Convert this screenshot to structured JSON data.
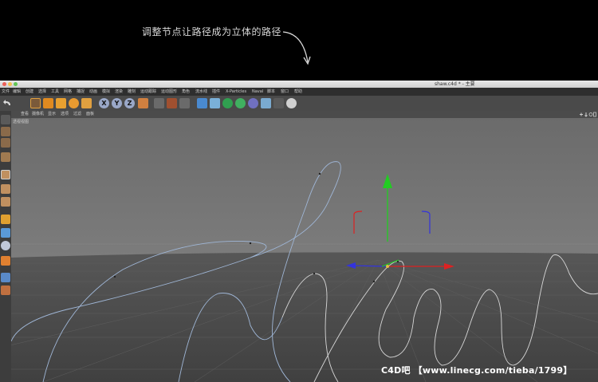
{
  "banner": {
    "caption": "调整节点让路径成为立体的路径"
  },
  "window": {
    "title": "shaw.c4d * - 主要"
  },
  "menu": {
    "items": [
      "文件",
      "编辑",
      "创建",
      "选择",
      "工具",
      "网格",
      "捕捉",
      "动画",
      "模拟",
      "渲染",
      "雕刻",
      "运动跟踪",
      "运动图形",
      "角色",
      "流水线",
      "插件",
      "X-Particles",
      "Naval",
      "脚本",
      "窗口",
      "帮助"
    ]
  },
  "viewport_menu": {
    "items": [
      "查看",
      "摄像机",
      "显示",
      "选项",
      "过滤",
      "面板"
    ]
  },
  "viewport": {
    "label": "透视视图"
  },
  "toolbar": {
    "x_label": "X",
    "y_label": "Y",
    "z_label": "Z"
  },
  "watermark": {
    "text": "C4D吧 【www.linecg.com/tieba/1799】"
  },
  "colors": {
    "spline": "#9fb6d6",
    "y_axis": "#22cc22",
    "x_axis": "#dd2222",
    "z_axis": "#3333dd",
    "grid": "#555555"
  }
}
